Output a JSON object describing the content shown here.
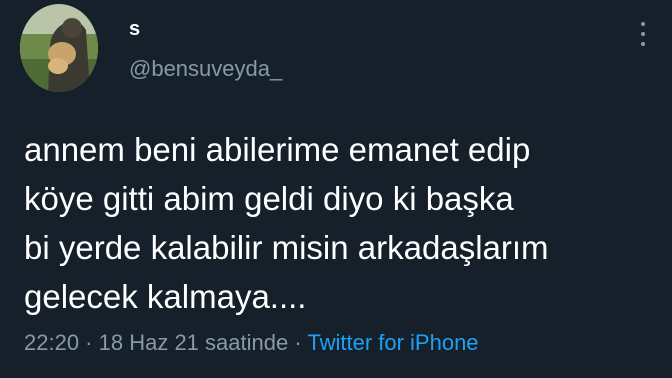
{
  "user": {
    "display_name": "s",
    "handle": "@bensuveyda_",
    "avatar": "profile-photo-person-holding-cat"
  },
  "tweet": {
    "text": "annem beni abilerime emanet edip\nköye gitti abim geldi diyo ki başka\nbi yerde kalabilir misin arkadaşlarım\ngelecek kalmaya....",
    "time": "22:20",
    "sep1": " · ",
    "date": "18 Haz 21 saatinde",
    "sep2": " · ",
    "source": "Twitter for iPhone"
  },
  "icons": {
    "more": "more-vertical-icon"
  },
  "colors": {
    "background": "#15202b",
    "text": "#ffffff",
    "muted": "#8899a6",
    "accent": "#1da1f2"
  }
}
